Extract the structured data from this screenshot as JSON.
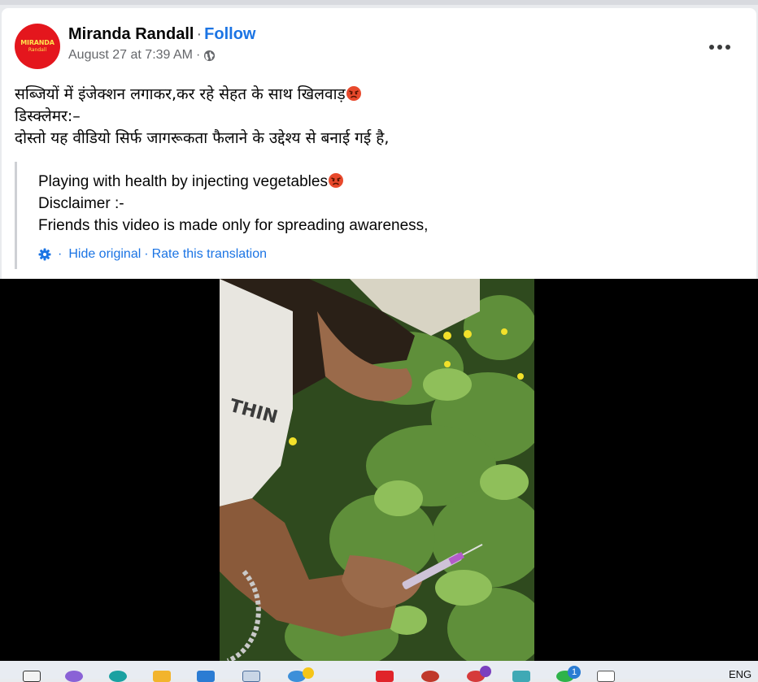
{
  "post": {
    "avatar_text_line1": "MIRANDA",
    "avatar_text_line2": "Randall",
    "author": "Miranda Randall",
    "separator": "·",
    "follow_label": "Follow",
    "timestamp": "August 27 at 7:39 AM",
    "privacy_icon": "globe-icon",
    "more_icon": "more-options-icon"
  },
  "original_text": [
    "सब्जियों में इंजेक्शन लगाकर,कर रहे सेहत के साथ खिलवाड़",
    "डिस्क्लेमर:–",
    "दोस्तो यह वीडियो सिर्फ जागरूकता फैलाने के उद्देश्य से बनाई गई है,"
  ],
  "translation": {
    "lines": [
      "Playing with health by injecting vegetables",
      "Disclaimer :-",
      "Friends this video is made only for spreading awareness,"
    ],
    "hide_original": "Hide original",
    "link_separator": "·",
    "rate_translation": "Rate this translation"
  },
  "emoji": {
    "name": "angry-face-emoji",
    "color": "#e8492c"
  },
  "colors": {
    "link": "#1b74e4",
    "secondary_text": "#65676b",
    "video_bg": "#000000"
  },
  "taskbar": {
    "language": "ENG",
    "badge_count": "1"
  }
}
